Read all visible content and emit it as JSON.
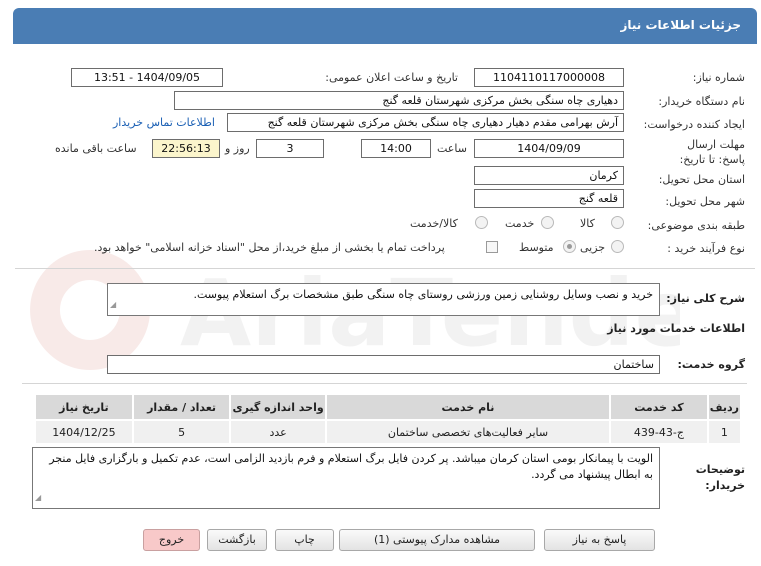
{
  "window": {
    "title": "جزئیات اطلاعات نیاز"
  },
  "header": {
    "need_number_label": "شماره نیاز:",
    "need_number": "1104110117000008",
    "announce_datetime_label": "تاریخ و ساعت اعلان عمومی:",
    "announce_datetime": "1404/09/05 - 13:51",
    "buyer_org_label": "نام دستگاه خریدار:",
    "buyer_org": "دهیاری چاه سنگی بخش مرکزی شهرستان قلعه گنج",
    "requester_label": "ایجاد کننده درخواست:",
    "requester": "آرش بهرامی مقدم دهیار دهیاری چاه سنگی بخش مرکزی شهرستان قلعه گنج",
    "buyer_contact_link": "اطلاعات تماس خریدار",
    "deadline_label": "مهلت ارسال پاسخ: تا تاریخ:",
    "deadline_date": "1404/09/09",
    "time_label": "ساعت",
    "deadline_time": "14:00",
    "days_value": "3",
    "days_label": "روز و",
    "remaining_time": "22:56:13",
    "remaining_label": "ساعت باقی مانده",
    "province_label": "استان محل تحویل:",
    "province": "کرمان",
    "city_label": "شهر محل تحویل:",
    "city": "قلعه گنج",
    "category_label": "طبقه بندی موضوعی:",
    "category_options": [
      "کالا",
      "خدمت",
      "کالا/خدمت"
    ],
    "purchase_type_label": "نوع فرآیند خرید :",
    "purchase_type_options": [
      "جزیی",
      "متوسط"
    ],
    "treasury_note": "پرداخت تمام یا بخشی از مبلغ خرید،از محل \"اسناد خزانه اسلامی\" خواهد بود."
  },
  "summary": {
    "label": "شرح کلی نیاز:",
    "text": "خرید و نصب وسایل روشنایی زمین ورزشی روستای چاه سنگی طبق مشخصات برگ استعلام پیوست."
  },
  "services": {
    "section_title": "اطلاعات خدمات مورد نیاز",
    "group_label": "گروه خدمت:",
    "group_value": "ساختمان",
    "columns": [
      "ردیف",
      "کد خدمت",
      "نام خدمت",
      "واحد اندازه گیری",
      "تعداد / مقدار",
      "تاریخ نیاز"
    ],
    "rows": [
      [
        "1",
        "ج-43-439",
        "سایر فعالیت‌های تخصصی ساختمان",
        "عدد",
        "5",
        "1404/12/25"
      ]
    ]
  },
  "buyer_notes": {
    "label": "توضیحات خریدار:",
    "text": "الویت با پیمانکار بومی استان کرمان میباشد. پر کردن فایل برگ استعلام و فرم بازدید الزامی است، عدم تکمیل و بارگزاری فایل منجر به ابطال پیشنهاد می گردد."
  },
  "buttons": {
    "reply": "پاسخ به نیاز",
    "view_docs": "مشاهده مدارک پیوستی (1)",
    "print": "چاپ",
    "back": "بازگشت",
    "exit": "خروج"
  },
  "watermark_text": "AriaTender.net",
  "colors": {
    "titlebar": "#4a7db4",
    "remaining_bg": "#fbf5cc",
    "link": "#1a5fb4",
    "exit_bg": "#f8c9c9"
  }
}
